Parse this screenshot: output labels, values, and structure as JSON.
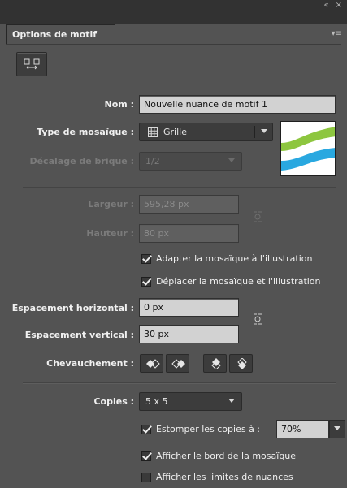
{
  "window": {
    "collapse_glyph": "«",
    "close_glyph": "×",
    "menu_glyph": "▾≡"
  },
  "tab": {
    "title": "Options de motif"
  },
  "tools": {
    "tile_tool_icon": "pattern-tile-tool-icon"
  },
  "fields": {
    "name": {
      "label": "Nom :",
      "value": "Nouvelle nuance de motif 1"
    },
    "tile_type": {
      "label": "Type de mosaïque :",
      "value": "Grille",
      "icon": "grid-icon"
    },
    "brick_offset": {
      "label": "Décalage de brique :",
      "value": "1/2",
      "disabled": true
    },
    "width": {
      "label": "Largeur :",
      "value": "595,28 px",
      "disabled": true
    },
    "height": {
      "label": "Hauteur :",
      "value": "80 px",
      "disabled": true
    },
    "h_spacing": {
      "label": "Espacement horizontal :",
      "value": "0 px"
    },
    "v_spacing": {
      "label": "Espacement vertical :",
      "value": "30 px"
    },
    "overlap": {
      "label": "Chevauchement :"
    },
    "copies": {
      "label": "Copies :",
      "value": "5 x 5"
    },
    "dim_opacity": {
      "value": "70%"
    }
  },
  "checkboxes": {
    "size_tile_to_art": {
      "label": "Adapter la mosaïque à l'illustration",
      "checked": true
    },
    "move_tile_with_art": {
      "label": "Déplacer la mosaïque et l'illustration",
      "checked": true
    },
    "dim_copies": {
      "label": "Estomper les copies à :",
      "checked": true
    },
    "show_tile_edge": {
      "label": "Afficher le bord de la mosaïque",
      "checked": true
    },
    "show_swatch_bounds": {
      "label": "Afficher les limites de nuances",
      "checked": false
    }
  },
  "colors": {
    "panel": "#535353",
    "swatch_green": "#8dc63f",
    "swatch_blue": "#29a8e0"
  }
}
